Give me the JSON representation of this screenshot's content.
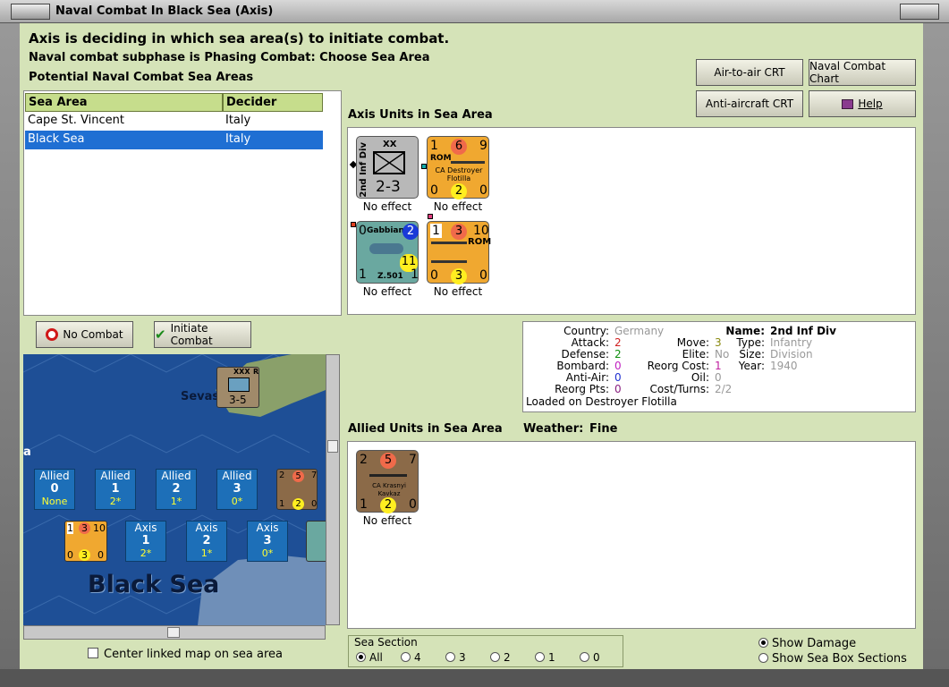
{
  "window": {
    "title": "Naval Combat In Black Sea (Axis)"
  },
  "header": {
    "line1": "Axis is deciding in which sea area(s) to initiate combat.",
    "line2": "Naval combat subphase is Phasing Combat: Choose Sea Area",
    "line3": "Potential Naval Combat Sea Areas"
  },
  "buttons": {
    "air_to_air": "Air-to-air CRT",
    "naval_chart": "Naval Combat Chart",
    "anti_aircraft": "Anti-aircraft CRT",
    "help": "Help",
    "no_combat": "No Combat",
    "initiate_combat": "Initiate Combat"
  },
  "sea_table": {
    "headers": [
      "Sea Area",
      "Decider"
    ],
    "rows": [
      {
        "area": "Cape St. Vincent",
        "decider": "Italy"
      },
      {
        "area": "Black Sea",
        "decider": "Italy"
      }
    ]
  },
  "axis_units": {
    "label": "Axis Units in Sea Area",
    "units": [
      {
        "name": "2nd Inf Div",
        "size": "XX",
        "values": "2-3",
        "effect": "No effect"
      },
      {
        "nation": "ROM",
        "name": "CA Destroyer Flotilla",
        "top": [
          "1",
          "6",
          "9"
        ],
        "bottom": [
          "0",
          "2",
          "0"
        ],
        "effect": "No effect"
      },
      {
        "name": "Gabbiano",
        "code": "Z.501",
        "left_top": "0",
        "right_top": "2",
        "left_bot": "1",
        "right_mid": "11",
        "right_bot": "1",
        "effect": "No effect"
      },
      {
        "nation": "ROM",
        "top": [
          "1",
          "3",
          "10"
        ],
        "bottom": [
          "0",
          "3",
          "0"
        ],
        "effect": "No effect"
      }
    ]
  },
  "info": {
    "labels": {
      "country": "Country:",
      "attack": "Attack:",
      "defense": "Defense:",
      "bombard": "Bombard:",
      "antiair": "Anti-Air:",
      "reorg_pts": "Reorg Pts:",
      "move": "Move:",
      "elite": "Elite:",
      "reorg_cost": "Reorg Cost:",
      "oil": "Oil:",
      "cost_turns": "Cost/Turns:",
      "name": "Name:",
      "type": "Type:",
      "size": "Size:",
      "year": "Year:"
    },
    "country": "Germany",
    "attack": "2",
    "defense": "2",
    "bombard": "0",
    "antiair": "0",
    "reorg_pts": "0",
    "move": "3",
    "elite": "No",
    "reorg_cost": "1",
    "oil": "0",
    "cost_turns": "2/2",
    "name": "2nd Inf Div",
    "type": "Infantry",
    "size": "Division",
    "year": "1940",
    "loaded": "Loaded on Destroyer Flotilla"
  },
  "allied_units": {
    "label": "Allied Units in Sea Area",
    "weather_label": "Weather:",
    "weather": "Fine",
    "units": [
      {
        "name": "CA Krasnyi Kavkaz",
        "top": [
          "2",
          "5",
          "7"
        ],
        "bottom": [
          "1",
          "2",
          "0"
        ],
        "effect": "No effect"
      }
    ]
  },
  "map": {
    "sea_name": "Black Sea",
    "city": "Sevas",
    "land_counter": {
      "size": "XXX",
      "nation": "R",
      "values": "3-5"
    },
    "allied_boxes": [
      {
        "label": "Allied",
        "num": "0",
        "sub": "None"
      },
      {
        "label": "Allied",
        "num": "1",
        "sub": "2*"
      },
      {
        "label": "Allied",
        "num": "2",
        "sub": "1*"
      },
      {
        "label": "Allied",
        "num": "3",
        "sub": "0*"
      }
    ],
    "axis_boxes": [
      {
        "label": "Axis",
        "num": "1",
        "sub": "2*"
      },
      {
        "label": "Axis",
        "num": "2",
        "sub": "1*"
      },
      {
        "label": "Axis",
        "num": "3",
        "sub": "0*"
      }
    ],
    "left_edge_letter": "a"
  },
  "center_linked": "Center linked map on sea area",
  "sea_section": {
    "label": "Sea Section",
    "options": [
      "All",
      "4",
      "3",
      "2",
      "1",
      "0"
    ],
    "selected": "All"
  },
  "display_options": {
    "show_damage": "Show Damage",
    "show_sea_box": "Show Sea Box Sections"
  },
  "colors": {
    "client_bg": "#d5e3b8",
    "selected_row": "#1f6fd3",
    "axis_counter": "#f0a830",
    "soviet_counter": "#8b6a48",
    "italy_air": "#6aa8a0"
  }
}
